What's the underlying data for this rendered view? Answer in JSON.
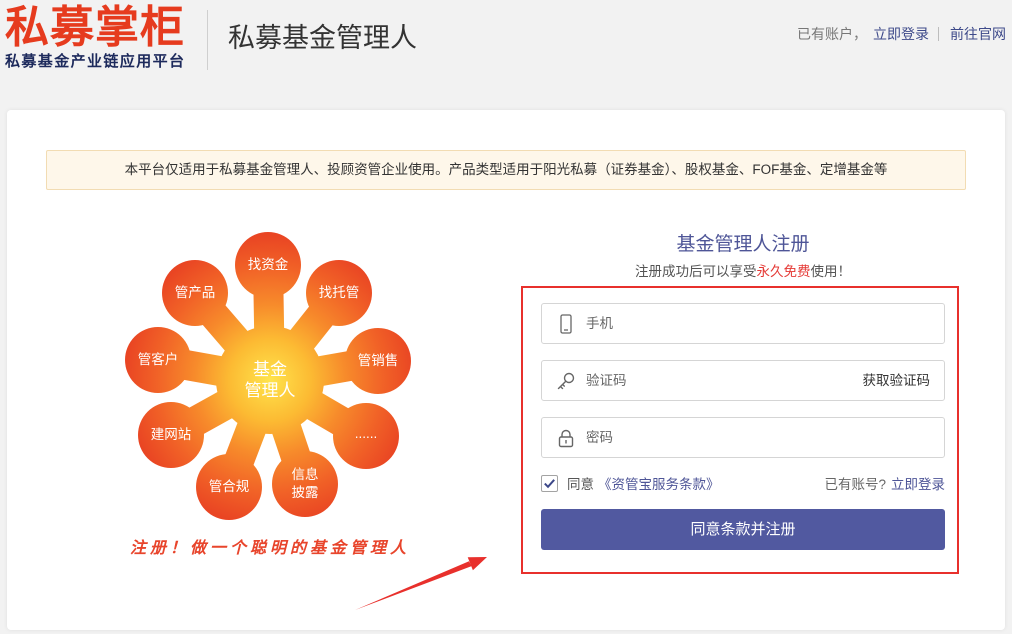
{
  "header": {
    "logo_title": "私募掌柜",
    "logo_subtitle": "私募基金产业链应用平台",
    "page_title": "私募基金管理人",
    "account_prompt": "已有账户，",
    "login_link": "立即登录",
    "official_site_link": "前往官网"
  },
  "notice": {
    "text": "本平台仅适用于私募基金管理人、投顾资管企业使用。产品类型适用于阳光私募（证券基金）、股权基金、FOF基金、定增基金等"
  },
  "illustration": {
    "center_line1": "基金",
    "center_line2": "管理人",
    "petals": [
      {
        "label": "找资金"
      },
      {
        "label": "找托管"
      },
      {
        "label": "管销售"
      },
      {
        "label": "......"
      },
      {
        "label": "信息\n披露"
      },
      {
        "label": "管合规"
      },
      {
        "label": "建网站"
      },
      {
        "label": "管客户"
      },
      {
        "label": "管产品"
      }
    ],
    "slogan": "注册！做一个聪明的基金管理人"
  },
  "register": {
    "title": "基金管理人注册",
    "subtitle_prefix": "注册成功后可以享受",
    "subtitle_highlight": "永久免费",
    "subtitle_suffix": "使用！",
    "phone_placeholder": "手机",
    "code_placeholder": "验证码",
    "get_code_label": "获取验证码",
    "password_placeholder": "密码",
    "agree_checked": true,
    "agree_label": "同意",
    "terms_link": "《资管宝服务条款》",
    "has_account": "已有账号?",
    "login_link": "立即登录",
    "submit_label": "同意条款并注册"
  },
  "icons": {
    "phone_field": "phone-icon",
    "code_field": "key-icon",
    "password_field": "lock-icon",
    "agree_checkbox": "checkmark-icon",
    "annotation": "arrow-icon"
  },
  "colors": {
    "brand_red": "#e63b1e",
    "logo_navy": "#1d2a5c",
    "link_blue": "#3e4a8a",
    "title_blue": "#4e5597",
    "accent": "#5159a0",
    "highlight_red": "#e53935",
    "annotation_red": "#e8302c",
    "slogan_red": "#e8452c",
    "notice_bg": "#fef7ea",
    "notice_border": "#f2dcb3"
  }
}
